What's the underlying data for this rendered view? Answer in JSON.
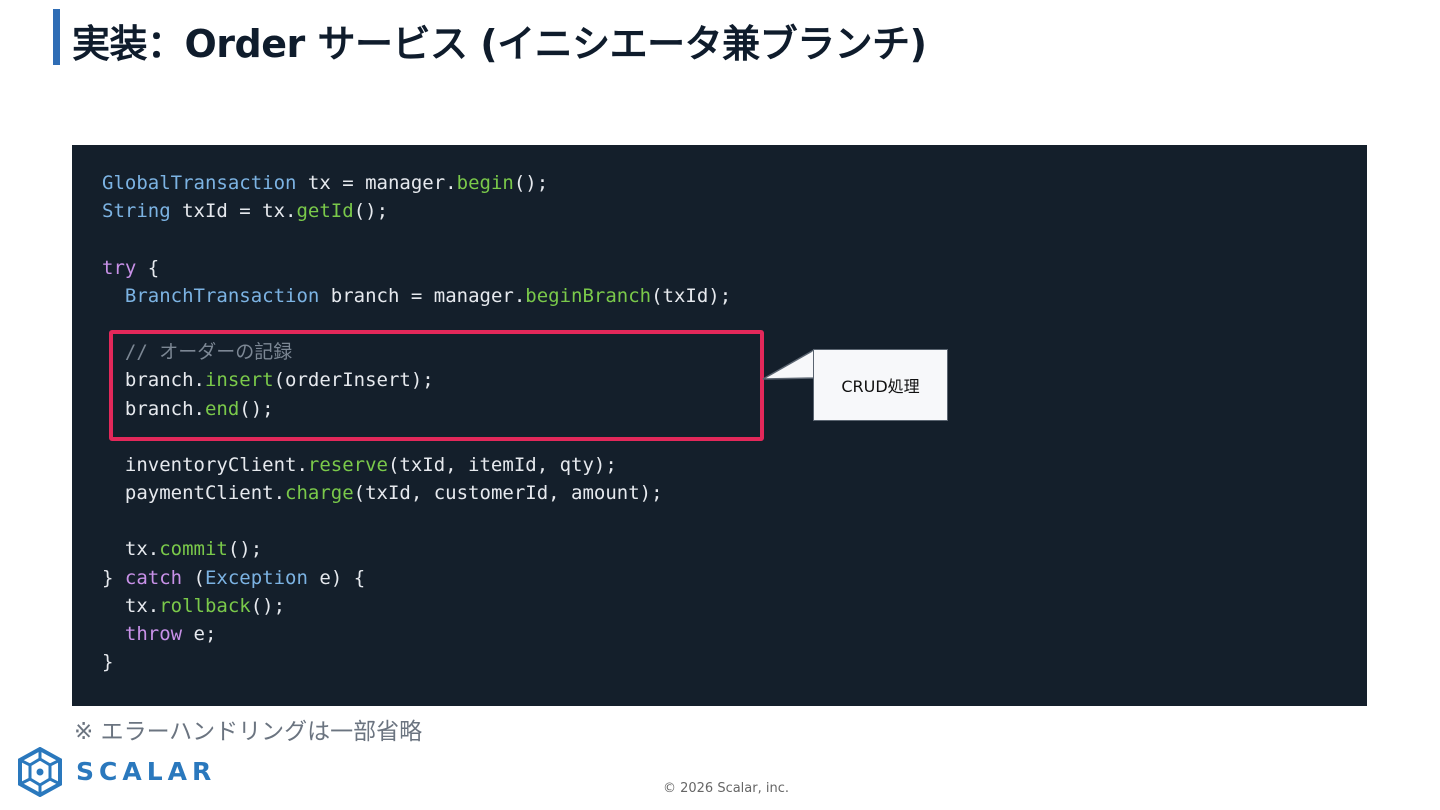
{
  "slide": {
    "title": "実装：Order サービス (イニシエータ兼ブランチ)",
    "callout": "CRUD処理",
    "note": "※ エラーハンドリングは一部省略",
    "brand": "SCALAR",
    "copyright": "© 2026 Scalar, inc."
  },
  "code": {
    "lines": [
      [
        {
          "t": "GlobalTransaction",
          "c": "type"
        },
        {
          "t": " tx = manager."
        },
        {
          "t": "begin",
          "c": "fn"
        },
        {
          "t": "();"
        }
      ],
      [
        {
          "t": "String",
          "c": "type"
        },
        {
          "t": " txId = tx."
        },
        {
          "t": "getId",
          "c": "fn"
        },
        {
          "t": "();"
        }
      ],
      [],
      [
        {
          "t": "try",
          "c": "kw"
        },
        {
          "t": " {"
        }
      ],
      [
        {
          "t": "  "
        },
        {
          "t": "BranchTransaction",
          "c": "type"
        },
        {
          "t": " branch = manager."
        },
        {
          "t": "beginBranch",
          "c": "fn"
        },
        {
          "t": "(txId);"
        }
      ],
      [],
      [
        {
          "t": "  "
        },
        {
          "t": "// オーダーの記録",
          "c": "cm"
        }
      ],
      [
        {
          "t": "  branch."
        },
        {
          "t": "insert",
          "c": "fn"
        },
        {
          "t": "(orderInsert);"
        }
      ],
      [
        {
          "t": "  branch."
        },
        {
          "t": "end",
          "c": "fn"
        },
        {
          "t": "();"
        }
      ],
      [],
      [
        {
          "t": "  inventoryClient."
        },
        {
          "t": "reserve",
          "c": "fn"
        },
        {
          "t": "(txId, itemId, qty);"
        }
      ],
      [
        {
          "t": "  paymentClient."
        },
        {
          "t": "charge",
          "c": "fn"
        },
        {
          "t": "(txId, customerId, amount);"
        }
      ],
      [],
      [
        {
          "t": "  tx."
        },
        {
          "t": "commit",
          "c": "fn"
        },
        {
          "t": "();"
        }
      ],
      [
        {
          "t": "} "
        },
        {
          "t": "catch",
          "c": "kw"
        },
        {
          "t": " ("
        },
        {
          "t": "Exception",
          "c": "type"
        },
        {
          "t": " e) {"
        }
      ],
      [
        {
          "t": "  tx."
        },
        {
          "t": "rollback",
          "c": "fn"
        },
        {
          "t": "();"
        }
      ],
      [
        {
          "t": "  "
        },
        {
          "t": "throw",
          "c": "kw"
        },
        {
          "t": " e;"
        }
      ],
      [
        {
          "t": "}"
        }
      ]
    ]
  },
  "colors": {
    "accent": "#2f6db5",
    "code_background": "#141f2b",
    "highlight_border": "#e3285a",
    "brand": "#2a78bd"
  }
}
